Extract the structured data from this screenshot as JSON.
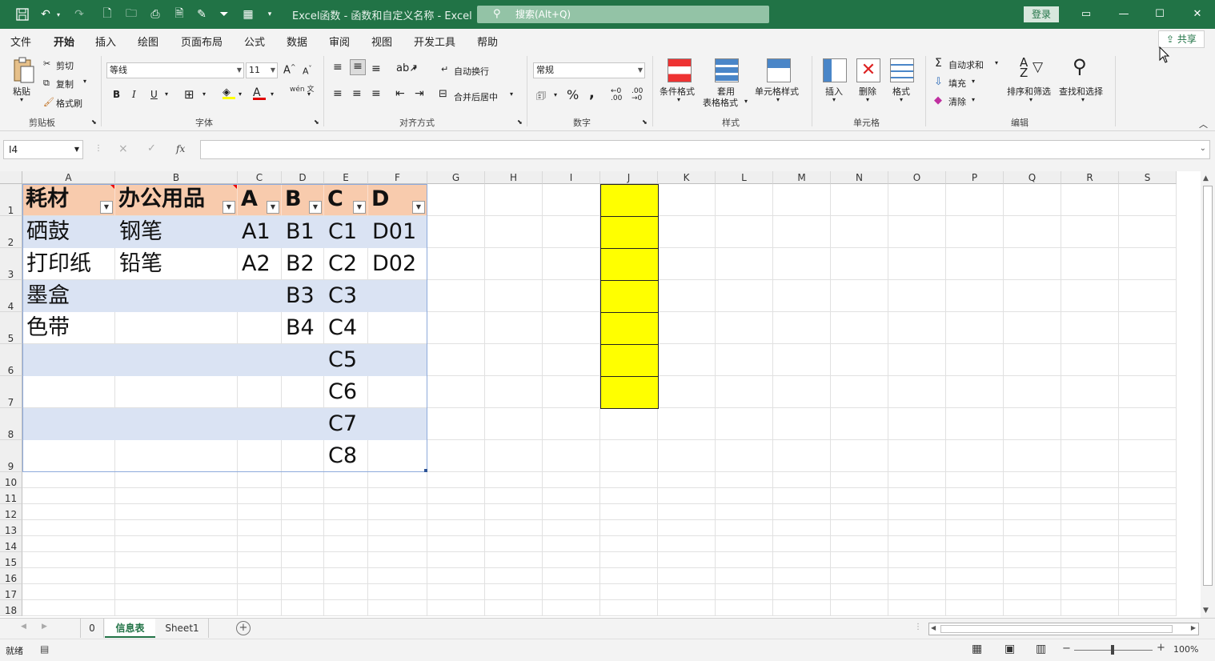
{
  "titlebar": {
    "title": "Excel函数 - 函数和自定义名称  -  Excel",
    "search_placeholder": "搜索(Alt+Q)",
    "login_label": "登录"
  },
  "menu": {
    "items": [
      "文件",
      "开始",
      "插入",
      "绘图",
      "页面布局",
      "公式",
      "数据",
      "审阅",
      "视图",
      "开发工具",
      "帮助"
    ],
    "active": "开始",
    "share_label": "共享"
  },
  "ribbon": {
    "clipboard": {
      "paste": "粘贴",
      "cut": "剪切",
      "copy": "复制",
      "format_painter": "格式刷",
      "group": "剪贴板"
    },
    "font": {
      "family": "等线",
      "size": "11",
      "group": "字体",
      "bold": "B",
      "italic": "I",
      "underline": "U",
      "grow": "A^",
      "shrink": "A˅",
      "phonetic": "wén 文"
    },
    "alignment": {
      "wrap": "自动换行",
      "merge": "合并后居中",
      "group": "对齐方式"
    },
    "number": {
      "format": "常规",
      "percent": "%",
      "comma": ",",
      "group": "数字"
    },
    "styles": {
      "conditional": "条件格式",
      "table_format_1": "套用",
      "table_format_2": "表格格式",
      "cell_styles": "单元格样式",
      "group": "样式"
    },
    "cells": {
      "insert": "插入",
      "delete": "删除",
      "format": "格式",
      "group": "单元格"
    },
    "editing": {
      "autosum": "自动求和",
      "fill": "填充",
      "clear": "清除",
      "sort_filter": "排序和筛选",
      "find_select": "查找和选择",
      "group": "编辑"
    }
  },
  "formula_bar": {
    "name_box": "I4",
    "formula": "",
    "cancel": "×",
    "enter": "✓",
    "fx": "fx"
  },
  "columns": [
    "A",
    "B",
    "C",
    "D",
    "E",
    "F",
    "G",
    "H",
    "I",
    "J",
    "K",
    "L",
    "M",
    "N",
    "O",
    "P",
    "Q",
    "R",
    "S"
  ],
  "rows": [
    "1",
    "2",
    "3",
    "4",
    "5",
    "6",
    "7",
    "8",
    "9",
    "10",
    "11",
    "12",
    "13",
    "14",
    "15",
    "16",
    "17",
    "18"
  ],
  "table": {
    "headers": [
      "耗材",
      "办公用品",
      "A",
      "B",
      "C",
      "D"
    ],
    "rows": [
      [
        "硒鼓",
        "钢笔",
        "A1",
        "B1",
        "C1",
        "D01"
      ],
      [
        "打印纸",
        "铅笔",
        "A2",
        "B2",
        "C2",
        "D02"
      ],
      [
        "墨盒",
        "",
        "",
        "B3",
        "C3",
        ""
      ],
      [
        "色带",
        "",
        "",
        "B4",
        "C4",
        ""
      ],
      [
        "",
        "",
        "",
        "",
        "C5",
        ""
      ],
      [
        "",
        "",
        "",
        "",
        "C6",
        ""
      ],
      [
        "",
        "",
        "",
        "",
        "C7",
        ""
      ],
      [
        "",
        "",
        "",
        "",
        "C8",
        ""
      ]
    ]
  },
  "highlight": {
    "column": "J",
    "rows": "1-7",
    "color": "#ffff00"
  },
  "sheets": {
    "tabs": [
      "0",
      "信息表",
      "Sheet1"
    ],
    "active": "信息表",
    "add": "+"
  },
  "status": {
    "ready": "就绪",
    "zoom": "100%"
  },
  "colors": {
    "brand": "#217346",
    "header_fill": "#f8cbad",
    "band_fill": "#dae3f3",
    "highlight": "#ffff00"
  }
}
